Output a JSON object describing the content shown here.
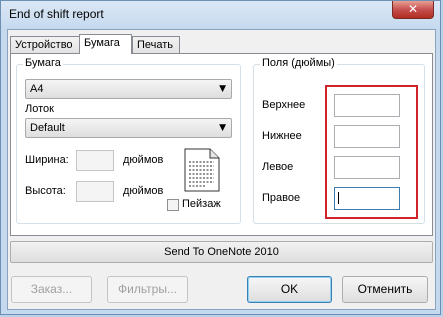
{
  "window": {
    "title": "End of shift report",
    "close_glyph": "✕"
  },
  "tabs": [
    {
      "label": "Устройство",
      "active": false
    },
    {
      "label": "Бумага",
      "active": true
    },
    {
      "label": "Печать",
      "active": false
    }
  ],
  "paper": {
    "group_title": "Бумага",
    "size_value": "A4",
    "tray_label": "Лоток",
    "tray_value": "Default",
    "width_label": "Ширина:",
    "width_value": "",
    "height_label": "Высота:",
    "height_value": "",
    "unit": "дюймов",
    "landscape_label": "Пейзаж",
    "landscape_checked": false
  },
  "margins": {
    "group_title": "Поля (дюймы)",
    "top_label": "Верхнее",
    "top_value": "",
    "bottom_label": "Нижнее",
    "bottom_value": "",
    "left_label": "Левое",
    "left_value": "",
    "right_label": "Правое",
    "right_value": ""
  },
  "printer_button": "Send To OneNote 2010",
  "buttons": {
    "order": "Заказ...",
    "filters": "Фильтры...",
    "ok": "OK",
    "cancel": "Отменить"
  },
  "colors": {
    "highlight": "#d1232a",
    "accent": "#3c7fb1"
  },
  "icons": {
    "dropdown": "▼",
    "paper": "document-page-icon"
  }
}
